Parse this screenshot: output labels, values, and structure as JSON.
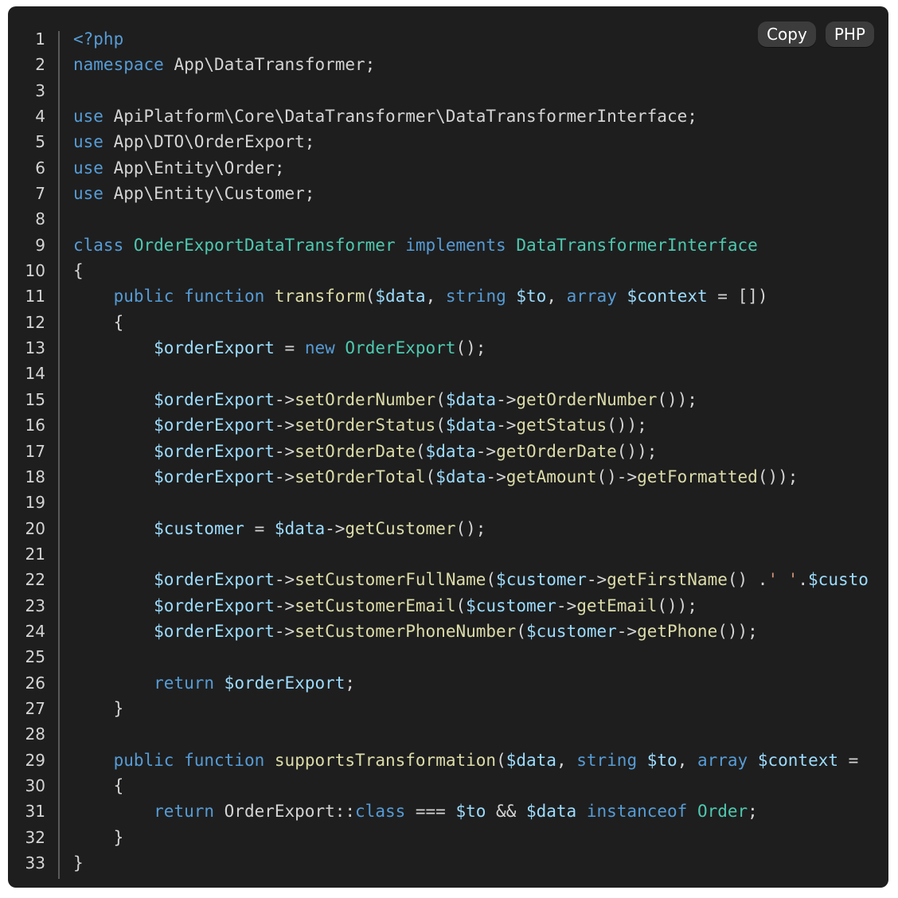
{
  "toolbar": {
    "copy_label": "Copy",
    "language_label": "PHP"
  },
  "colors": {
    "background": "#1e1e1e",
    "keyword": "#569cd6",
    "type": "#4ec9b0",
    "variable": "#9cdcfe",
    "function": "#dcdcaa",
    "string": "#ce9178",
    "plain": "#d4d4d4",
    "button": "#3c3c3c"
  },
  "code": {
    "line_numbers": [
      "1",
      "2",
      "3",
      "4",
      "5",
      "6",
      "7",
      "8",
      "9",
      "10",
      "11",
      "12",
      "13",
      "14",
      "15",
      "16",
      "17",
      "18",
      "19",
      "20",
      "21",
      "22",
      "23",
      "24",
      "25",
      "26",
      "27",
      "28",
      "29",
      "30",
      "31",
      "32",
      "33"
    ],
    "lines": [
      [
        [
          "kw",
          "<?php"
        ]
      ],
      [
        [
          "kw",
          "namespace"
        ],
        [
          "plain",
          " App\\DataTransformer;"
        ]
      ],
      [],
      [
        [
          "kw",
          "use"
        ],
        [
          "plain",
          " ApiPlatform\\Core\\DataTransformer\\DataTransformerInterface;"
        ]
      ],
      [
        [
          "kw",
          "use"
        ],
        [
          "plain",
          " App\\DTO\\OrderExport;"
        ]
      ],
      [
        [
          "kw",
          "use"
        ],
        [
          "plain",
          " App\\Entity\\Order;"
        ]
      ],
      [
        [
          "kw",
          "use"
        ],
        [
          "plain",
          " App\\Entity\\Customer;"
        ]
      ],
      [],
      [
        [
          "kw",
          "class"
        ],
        [
          "plain",
          " "
        ],
        [
          "type",
          "OrderExportDataTransformer"
        ],
        [
          "plain",
          " "
        ],
        [
          "kw",
          "implements"
        ],
        [
          "plain",
          " "
        ],
        [
          "type",
          "DataTransformerInterface"
        ]
      ],
      [
        [
          "plain",
          "{"
        ]
      ],
      [
        [
          "plain",
          "    "
        ],
        [
          "kw",
          "public"
        ],
        [
          "plain",
          " "
        ],
        [
          "kw",
          "function"
        ],
        [
          "plain",
          " "
        ],
        [
          "fn",
          "transform"
        ],
        [
          "plain",
          "("
        ],
        [
          "var",
          "$data"
        ],
        [
          "plain",
          ", "
        ],
        [
          "kw",
          "string"
        ],
        [
          "plain",
          " "
        ],
        [
          "var",
          "$to"
        ],
        [
          "plain",
          ", "
        ],
        [
          "kw",
          "array"
        ],
        [
          "plain",
          " "
        ],
        [
          "var",
          "$context"
        ],
        [
          "plain",
          " = [])"
        ]
      ],
      [
        [
          "plain",
          "    {"
        ]
      ],
      [
        [
          "plain",
          "        "
        ],
        [
          "var",
          "$orderExport"
        ],
        [
          "plain",
          " = "
        ],
        [
          "kw",
          "new"
        ],
        [
          "plain",
          " "
        ],
        [
          "type",
          "OrderExport"
        ],
        [
          "plain",
          "();"
        ]
      ],
      [],
      [
        [
          "plain",
          "        "
        ],
        [
          "var",
          "$orderExport"
        ],
        [
          "plain",
          "->"
        ],
        [
          "fn",
          "setOrderNumber"
        ],
        [
          "plain",
          "("
        ],
        [
          "var",
          "$data"
        ],
        [
          "plain",
          "->"
        ],
        [
          "fn",
          "getOrderNumber"
        ],
        [
          "plain",
          "());"
        ]
      ],
      [
        [
          "plain",
          "        "
        ],
        [
          "var",
          "$orderExport"
        ],
        [
          "plain",
          "->"
        ],
        [
          "fn",
          "setOrderStatus"
        ],
        [
          "plain",
          "("
        ],
        [
          "var",
          "$data"
        ],
        [
          "plain",
          "->"
        ],
        [
          "fn",
          "getStatus"
        ],
        [
          "plain",
          "());"
        ]
      ],
      [
        [
          "plain",
          "        "
        ],
        [
          "var",
          "$orderExport"
        ],
        [
          "plain",
          "->"
        ],
        [
          "fn",
          "setOrderDate"
        ],
        [
          "plain",
          "("
        ],
        [
          "var",
          "$data"
        ],
        [
          "plain",
          "->"
        ],
        [
          "fn",
          "getOrderDate"
        ],
        [
          "plain",
          "());"
        ]
      ],
      [
        [
          "plain",
          "        "
        ],
        [
          "var",
          "$orderExport"
        ],
        [
          "plain",
          "->"
        ],
        [
          "fn",
          "setOrderTotal"
        ],
        [
          "plain",
          "("
        ],
        [
          "var",
          "$data"
        ],
        [
          "plain",
          "->"
        ],
        [
          "fn",
          "getAmount"
        ],
        [
          "plain",
          "()->"
        ],
        [
          "fn",
          "getFormatted"
        ],
        [
          "plain",
          "());"
        ]
      ],
      [],
      [
        [
          "plain",
          "        "
        ],
        [
          "var",
          "$customer"
        ],
        [
          "plain",
          " = "
        ],
        [
          "var",
          "$data"
        ],
        [
          "plain",
          "->"
        ],
        [
          "fn",
          "getCustomer"
        ],
        [
          "plain",
          "();"
        ]
      ],
      [],
      [
        [
          "plain",
          "        "
        ],
        [
          "var",
          "$orderExport"
        ],
        [
          "plain",
          "->"
        ],
        [
          "fn",
          "setCustomerFullName"
        ],
        [
          "plain",
          "("
        ],
        [
          "var",
          "$customer"
        ],
        [
          "plain",
          "->"
        ],
        [
          "fn",
          "getFirstName"
        ],
        [
          "plain",
          "() ."
        ],
        [
          "str",
          "' '"
        ],
        [
          "plain",
          "."
        ],
        [
          "var",
          "$custo"
        ]
      ],
      [
        [
          "plain",
          "        "
        ],
        [
          "var",
          "$orderExport"
        ],
        [
          "plain",
          "->"
        ],
        [
          "fn",
          "setCustomerEmail"
        ],
        [
          "plain",
          "("
        ],
        [
          "var",
          "$customer"
        ],
        [
          "plain",
          "->"
        ],
        [
          "fn",
          "getEmail"
        ],
        [
          "plain",
          "());"
        ]
      ],
      [
        [
          "plain",
          "        "
        ],
        [
          "var",
          "$orderExport"
        ],
        [
          "plain",
          "->"
        ],
        [
          "fn",
          "setCustomerPhoneNumber"
        ],
        [
          "plain",
          "("
        ],
        [
          "var",
          "$customer"
        ],
        [
          "plain",
          "->"
        ],
        [
          "fn",
          "getPhone"
        ],
        [
          "plain",
          "());"
        ]
      ],
      [],
      [
        [
          "plain",
          "        "
        ],
        [
          "kw",
          "return"
        ],
        [
          "plain",
          " "
        ],
        [
          "var",
          "$orderExport"
        ],
        [
          "plain",
          ";"
        ]
      ],
      [
        [
          "plain",
          "    }"
        ]
      ],
      [],
      [
        [
          "plain",
          "    "
        ],
        [
          "kw",
          "public"
        ],
        [
          "plain",
          " "
        ],
        [
          "kw",
          "function"
        ],
        [
          "plain",
          " "
        ],
        [
          "fn",
          "supportsTransformation"
        ],
        [
          "plain",
          "("
        ],
        [
          "var",
          "$data"
        ],
        [
          "plain",
          ", "
        ],
        [
          "kw",
          "string"
        ],
        [
          "plain",
          " "
        ],
        [
          "var",
          "$to"
        ],
        [
          "plain",
          ", "
        ],
        [
          "kw",
          "array"
        ],
        [
          "plain",
          " "
        ],
        [
          "var",
          "$context"
        ],
        [
          "plain",
          " ="
        ]
      ],
      [
        [
          "plain",
          "    {"
        ]
      ],
      [
        [
          "plain",
          "        "
        ],
        [
          "kw",
          "return"
        ],
        [
          "plain",
          " OrderExport::"
        ],
        [
          "kw",
          "class"
        ],
        [
          "plain",
          " === "
        ],
        [
          "var",
          "$to"
        ],
        [
          "plain",
          " && "
        ],
        [
          "var",
          "$data"
        ],
        [
          "plain",
          " "
        ],
        [
          "kw",
          "instanceof"
        ],
        [
          "plain",
          " "
        ],
        [
          "type",
          "Order"
        ],
        [
          "plain",
          ";"
        ]
      ],
      [
        [
          "plain",
          "    }"
        ]
      ],
      [
        [
          "plain",
          "}"
        ]
      ]
    ]
  }
}
